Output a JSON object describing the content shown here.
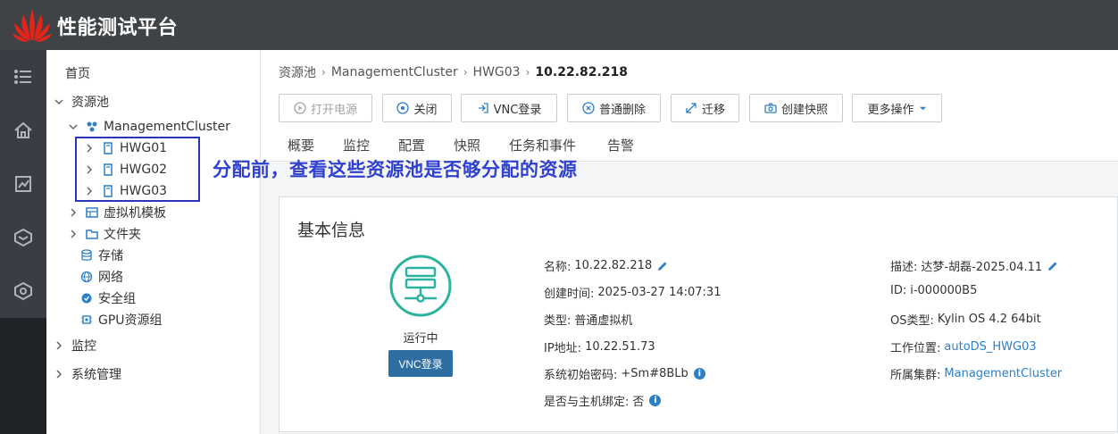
{
  "app": {
    "title": "性能测试平台"
  },
  "tree": {
    "home": "首页",
    "resource_pool": "资源池",
    "cluster": "ManagementCluster",
    "hosts": [
      "HWG01",
      "HWG02",
      "HWG03"
    ],
    "vm_template": "虚拟机模板",
    "folder": "文件夹",
    "storage": "存储",
    "network": "网络",
    "security_group": "安全组",
    "gpu_pool": "GPU资源组",
    "monitor": "监控",
    "system": "系统管理"
  },
  "annotation": {
    "text": "分配前，查看这些资源池是否够分配的资源",
    "color": "#2f3fcf"
  },
  "breadcrumb": {
    "items": [
      "资源池",
      "ManagementCluster",
      "HWG03"
    ],
    "current": "10.22.82.218"
  },
  "toolbar": {
    "power_on": "打开电源",
    "shutdown": "关闭",
    "vnc_login": "VNC登录",
    "delete": "普通删除",
    "migrate": "迁移",
    "snapshot": "创建快照",
    "more": "更多操作"
  },
  "tabs": [
    "概要",
    "监控",
    "配置",
    "快照",
    "任务和事件",
    "告警"
  ],
  "card": {
    "title": "基本信息",
    "status": "运行中",
    "vnc_button": "VNC登录",
    "left": {
      "name_label": "名称:",
      "name": "10.22.82.218",
      "created_label": "创建时间:",
      "created": "2025-03-27 14:07:31",
      "type_label": "类型:",
      "type": "普通虚拟机",
      "ip_label": "IP地址:",
      "ip": "10.22.51.73",
      "pwd_label": "系统初始密码:",
      "pwd": "+Sm#8BLb",
      "bind_label": "是否与主机绑定:",
      "bind": "否"
    },
    "right": {
      "desc_label": "描述:",
      "desc": "达梦-胡磊-2025.04.11",
      "id_label": "ID:",
      "id": "i-000000B5",
      "os_label": "OS类型:",
      "os": "Kylin OS 4.2 64bit",
      "location_label": "工作位置:",
      "location": "autoDS_HWG03",
      "cluster_label": "所属集群:",
      "cluster": "ManagementCluster"
    }
  },
  "colors": {
    "header": "#3f4346",
    "rail": "#1f2226",
    "accent": "#2d7fc8",
    "status": "#2bb3a0",
    "brand": "#e4231b"
  }
}
